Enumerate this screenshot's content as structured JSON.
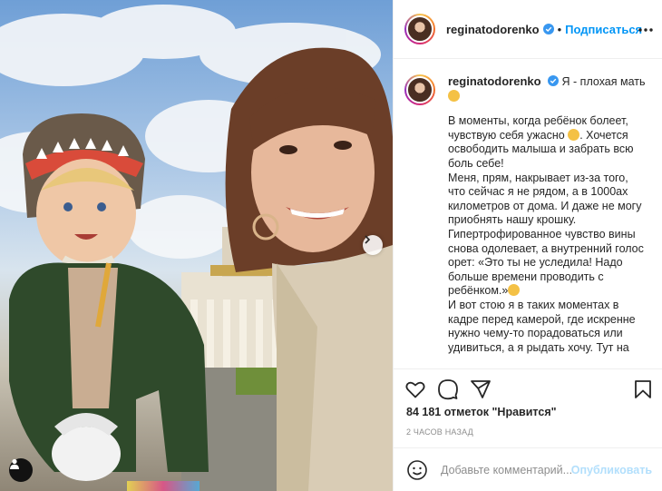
{
  "post": {
    "username": "reginatodorenko",
    "follow_label": "Подписаться",
    "separator": "•",
    "more_icon": "more-horizontal-icon",
    "caption": {
      "first_line": "Я - плохая мать",
      "paragraphs": [
        "В моменты, когда ребёнок болеет, чувствую себя ужасно",
        ". Хочется освободить малыша и забрать всю боль себе!",
        "Меня, прям, накрывает из-за того, что сейчас я не рядом, а в 1000ах километров от дома. И даже не могу приобнять нашу крошку. Гипертрофированное чувство вины снова одолевает, а внутренний голос орет: «Это ты не уследила! Надо больше времени проводить с ребёнком.»",
        "И вот стою я в таких моментах в кадре перед камерой, где искренне нужно чему-то порадоваться или удивиться, а я рыдать хочу. Тут на"
      ]
    },
    "likes_text": "84 181 отметок \"Нравится\"",
    "time_text": "2 часов назад",
    "comment_placeholder": "Добавьте комментарий...",
    "publish_label": "Опубликовать"
  },
  "icons": {
    "like": "heart-icon",
    "comment": "comment-icon",
    "share": "send-icon",
    "save": "bookmark-icon",
    "emoji": "smiley-icon",
    "carousel": "chevron-right-icon",
    "user_tag": "user-icon"
  },
  "colors": {
    "link_blue": "#0095f6",
    "publish_disabled": "#b2dffc",
    "verified_blue": "#3897f0",
    "muted_text": "#8e8e8e"
  }
}
